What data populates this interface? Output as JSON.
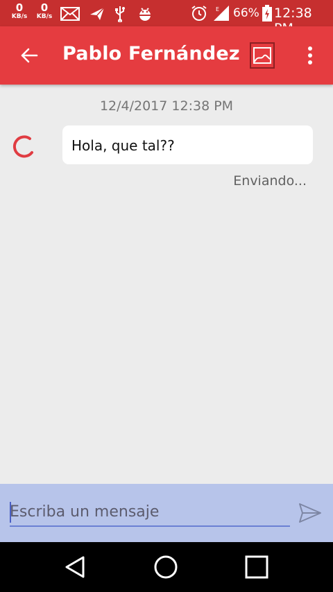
{
  "status_bar": {
    "speed_1": {
      "value": "0",
      "unit": "KB/s"
    },
    "speed_2": {
      "value": "0",
      "unit": "KB/s"
    },
    "battery_percent": "66%",
    "time": "12:38 PM",
    "icons": [
      "mail-icon",
      "send-notification-icon",
      "usb-icon",
      "android-debug-icon",
      "alarm-icon",
      "signal-icon",
      "battery-charging-icon"
    ]
  },
  "app_bar": {
    "title": "Pablo Fernández",
    "color": "#e53c40"
  },
  "conversation": {
    "timestamp": "12/4/2017 12:38 PM",
    "messages": [
      {
        "text": "Hola, que tal??",
        "status": "Enviando..."
      }
    ]
  },
  "composer": {
    "placeholder": "Escriba un mensaje",
    "value": ""
  }
}
